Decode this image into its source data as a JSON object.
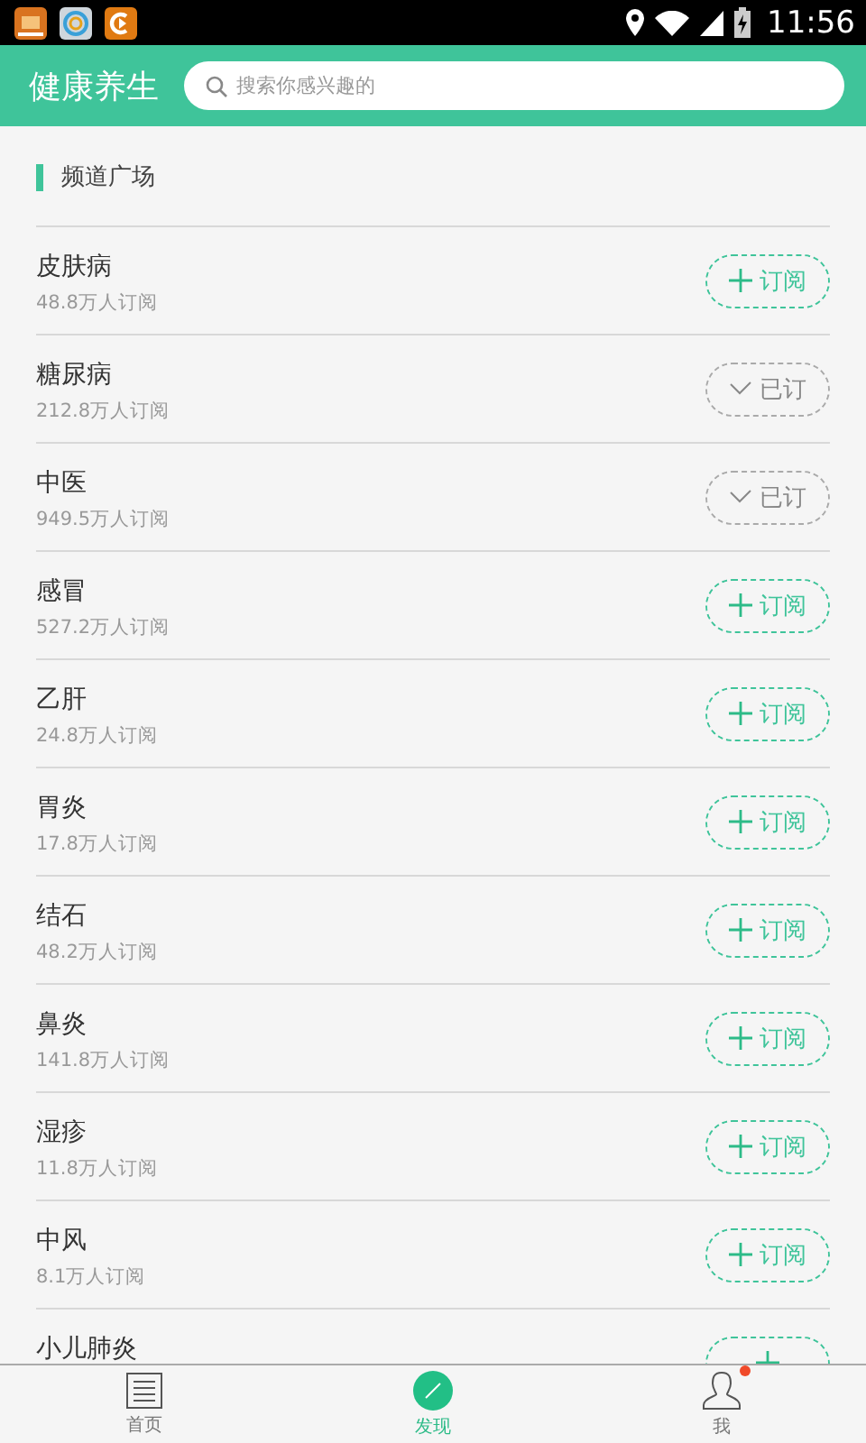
{
  "status_bar": {
    "time": "11:56"
  },
  "header": {
    "title": "健康养生",
    "search": {
      "placeholder": "搜索你感兴趣的"
    }
  },
  "section": {
    "title": "频道广场"
  },
  "channels": [
    {
      "name": "皮肤病",
      "count": "48.8万人订阅",
      "subscribed": false,
      "button": "订阅"
    },
    {
      "name": "糖尿病",
      "count": "212.8万人订阅",
      "subscribed": true,
      "button": "已订"
    },
    {
      "name": "中医",
      "count": "949.5万人订阅",
      "subscribed": true,
      "button": "已订"
    },
    {
      "name": "感冒",
      "count": "527.2万人订阅",
      "subscribed": false,
      "button": "订阅"
    },
    {
      "name": "乙肝",
      "count": "24.8万人订阅",
      "subscribed": false,
      "button": "订阅"
    },
    {
      "name": "胃炎",
      "count": "17.8万人订阅",
      "subscribed": false,
      "button": "订阅"
    },
    {
      "name": "结石",
      "count": "48.2万人订阅",
      "subscribed": false,
      "button": "订阅"
    },
    {
      "name": "鼻炎",
      "count": "141.8万人订阅",
      "subscribed": false,
      "button": "订阅"
    },
    {
      "name": "湿疹",
      "count": "11.8万人订阅",
      "subscribed": false,
      "button": "订阅"
    },
    {
      "name": "中风",
      "count": "8.1万人订阅",
      "subscribed": false,
      "button": "订阅"
    },
    {
      "name": "小儿肺炎",
      "subscribed": false
    }
  ],
  "bottom_nav": [
    {
      "label": "首页",
      "kind": "home",
      "selected": false,
      "badge": false
    },
    {
      "label": "发现",
      "kind": "discover",
      "selected": true,
      "badge": false
    },
    {
      "label": "我",
      "kind": "me",
      "selected": false,
      "badge": true
    }
  ]
}
